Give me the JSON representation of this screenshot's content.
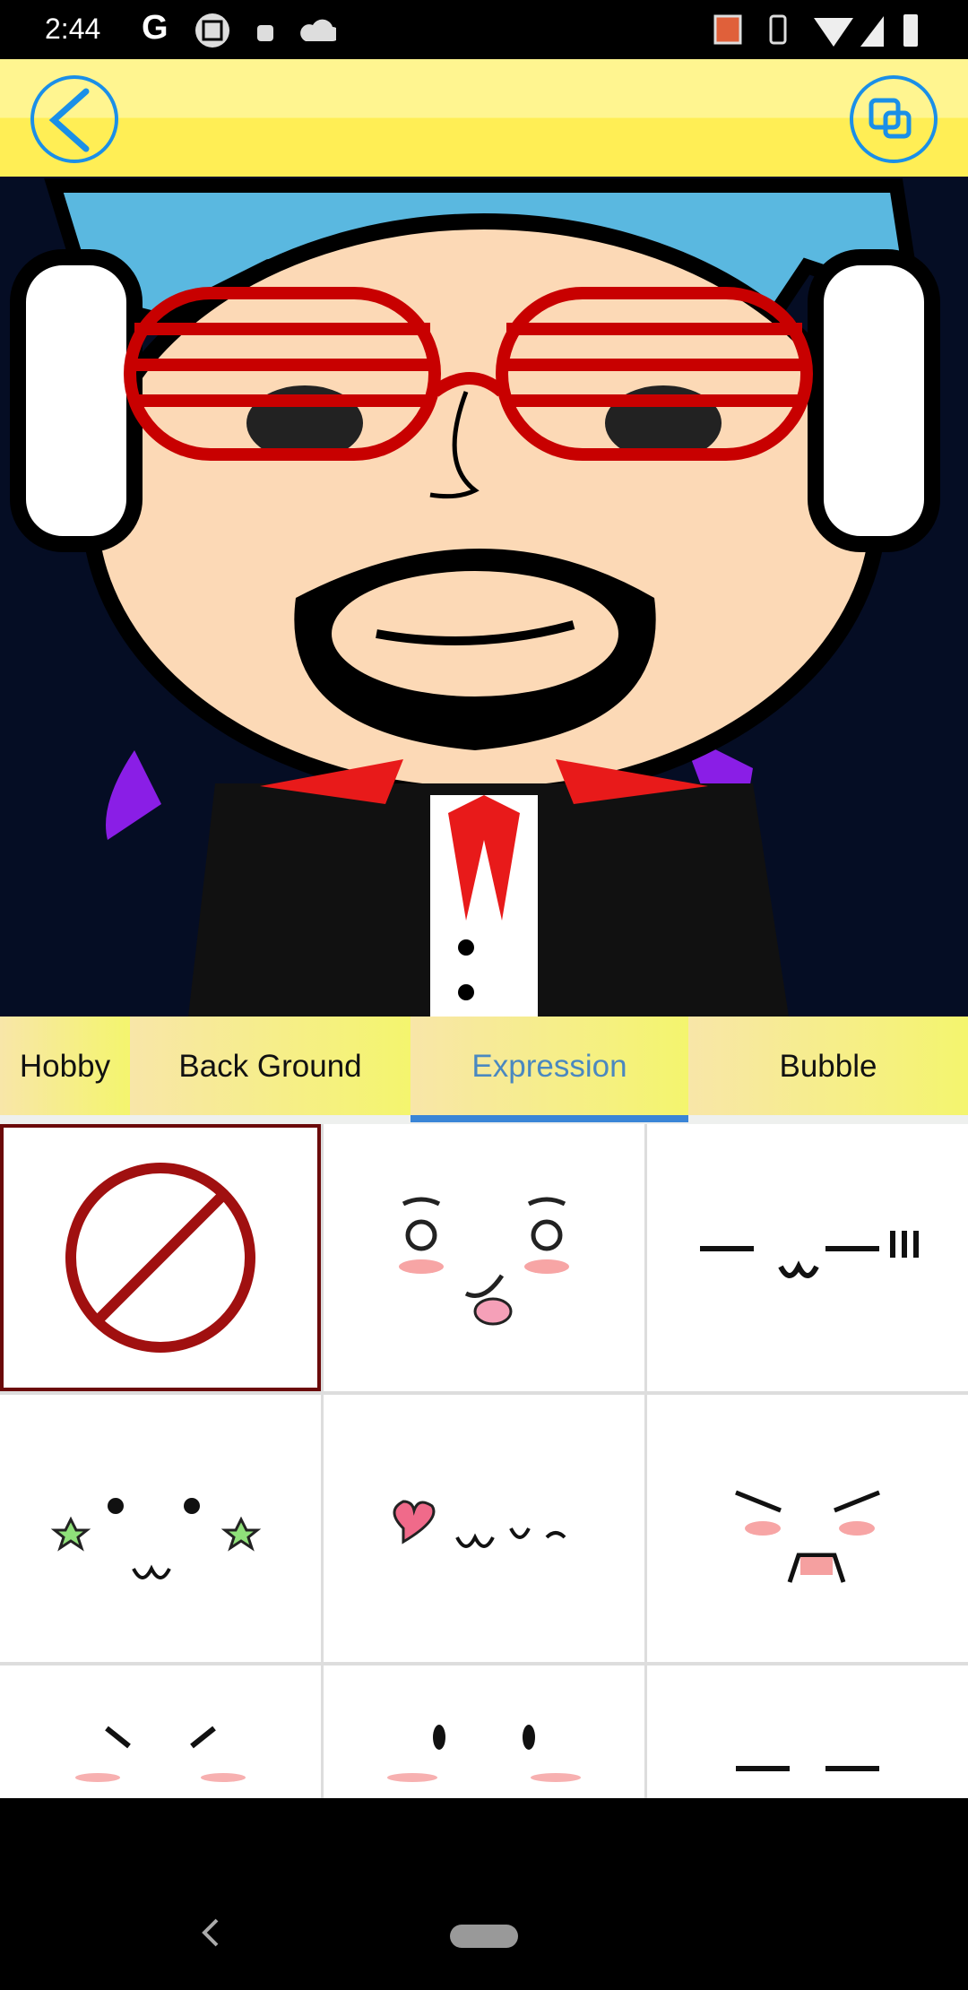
{
  "status_bar": {
    "time": "2:44",
    "left_icons": [
      "google-icon",
      "screenshot-icon",
      "android-icon",
      "cloud-icon"
    ],
    "right_icons": [
      "cast-icon",
      "vibrate-icon",
      "wifi-icon",
      "signal-icon",
      "battery-charging-icon"
    ]
  },
  "top_bar": {
    "back_icon": "chevron-left-icon",
    "right_icon": "copy-layers-icon",
    "accent": "#1a8fe8"
  },
  "tabs": [
    {
      "label": "Hobby",
      "visible": "bby"
    },
    {
      "label": "Back Ground"
    },
    {
      "label": "Expression",
      "active": true
    },
    {
      "label": "Bubble"
    }
  ],
  "tab_visible": {
    "hobby": "bby"
  },
  "colors": {
    "active_tab": "#4a88c0",
    "indicator": "#3a85d6",
    "selected_border": "#6b0a0a"
  },
  "expressions": [
    "none",
    "tongue-out",
    "line-omega-exclaim",
    "star-eyes",
    "heart-omega",
    "angry-fang",
    "blush-dash",
    "blush-dots",
    "flat-lines"
  ]
}
